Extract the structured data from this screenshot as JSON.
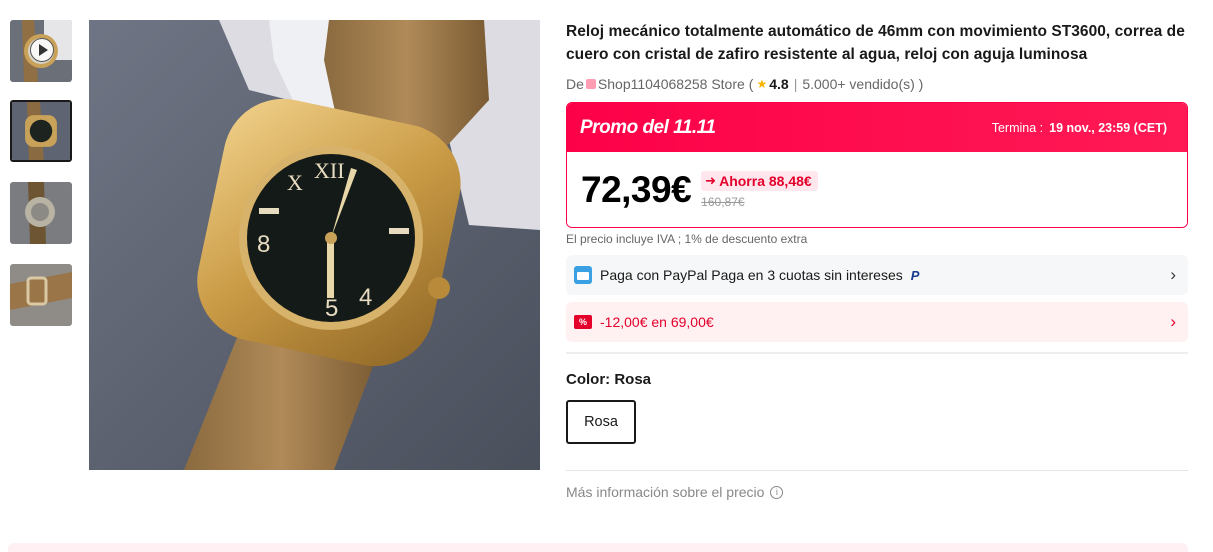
{
  "gallery": {
    "thumbnails": [
      {
        "name": "video-thumbnail",
        "is_video": true
      },
      {
        "name": "front-view",
        "selected": true
      },
      {
        "name": "back-view"
      },
      {
        "name": "buckle-view"
      }
    ]
  },
  "product": {
    "title": "Reloj mecánico totalmente automático de 46mm con movimiento ST3600, correa de cuero con cristal de zafiro resistente al agua, reloj con aguja luminosa",
    "store_prefix": "De",
    "store_name": "Shop1104068258 Store",
    "open_paren": "(",
    "rating": "4.8",
    "separator": "|",
    "sold": "5.000+ vendido(s) )"
  },
  "promo": {
    "title": "Promo del 11.11",
    "ends_label": "Termina :",
    "ends_date": "19 nov., 23:59 (CET)",
    "price": "72,39€",
    "saving": "Ahorra 88,48€",
    "old_price": "160,87€",
    "tax_note": "El precio incluye IVA ; 1% de descuento extra"
  },
  "payment": {
    "paypal_label": "Paga con PayPal Paga en 3 cuotas sin intereses",
    "paypal_badge": "P",
    "coupon_label": "-12,00€ en 69,00€",
    "coupon_icon": "%"
  },
  "variant": {
    "color_label": "Color: Rosa",
    "options": [
      "Rosa"
    ]
  },
  "more_info": "Más información sobre el precio",
  "icons": {
    "chevron": "›",
    "star": "★",
    "info": "i",
    "tag": "➜"
  },
  "colors": {
    "accent": "#fd0148",
    "coupon_bg": "#fff0f2",
    "paypal_bg": "#f5f7f8"
  }
}
